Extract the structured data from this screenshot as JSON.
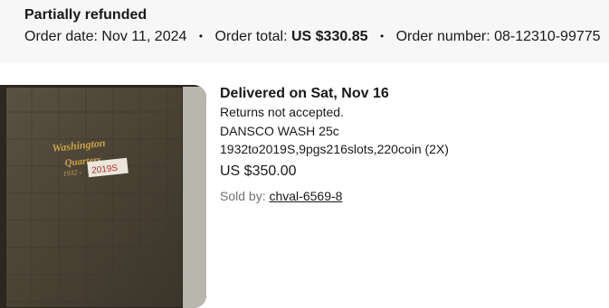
{
  "order": {
    "status": "Partially refunded",
    "date_label": "Order date:",
    "date_value": "Nov 11, 2024",
    "total_label": "Order total:",
    "total_value": "US $330.85",
    "number_label": "Order number:",
    "number_value": "08-12310-99775",
    "separator": "•"
  },
  "item": {
    "delivery_status": "Delivered on Sat, Nov 16",
    "returns_policy": "Returns not accepted.",
    "title": "DANSCO WASH 25c 1932to2019S,9pgs216slots,220coin (2X)",
    "price": "US $350.00",
    "seller_label": "Sold by:",
    "seller_name": "chval-6569-8",
    "image": {
      "line1": "Washington",
      "line2": "Quarters",
      "line3": "1932 -",
      "label_text": "2019S"
    }
  },
  "colors": {
    "header_bg": "#f7f7f7",
    "text": "#191919",
    "muted": "#707070",
    "album": "#4a4234",
    "gold": "#c9a24a"
  }
}
